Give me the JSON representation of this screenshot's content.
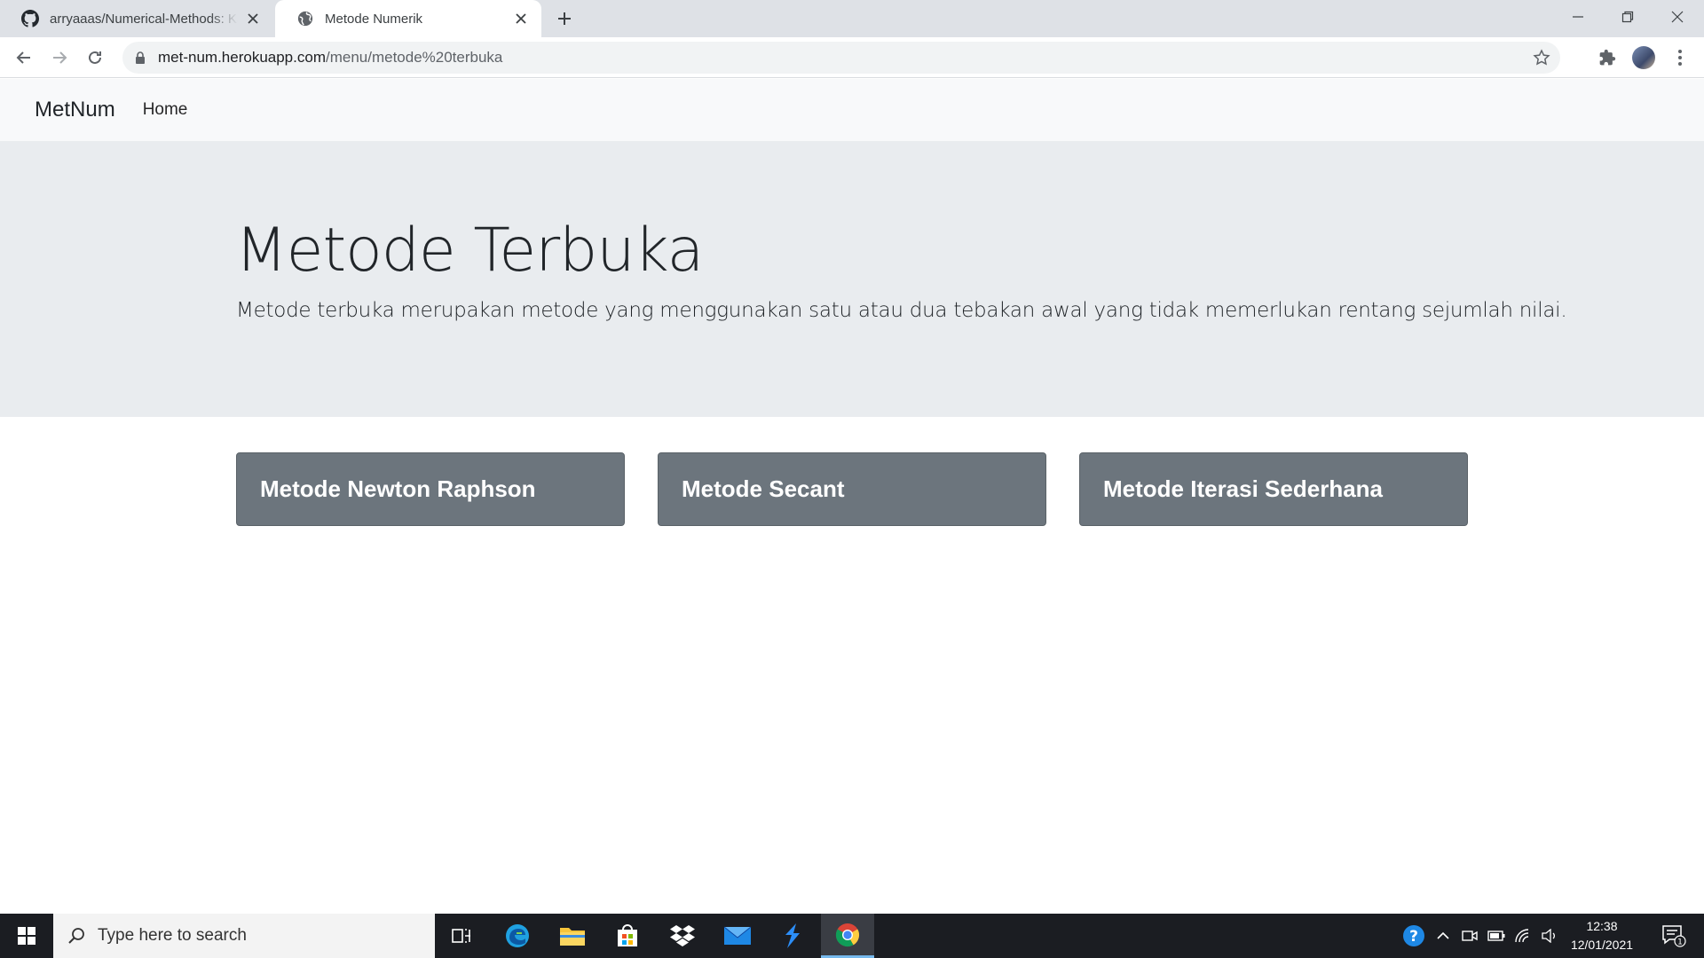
{
  "browser": {
    "tabs": [
      {
        "title": "arryaaas/Numerical-Methods: Ka",
        "icon": "github-icon",
        "active": false
      },
      {
        "title": "Metode Numerik",
        "icon": "globe-icon",
        "active": true
      }
    ],
    "url_host": "met-num.herokuapp.com",
    "url_path": "/menu/metode%20terbuka"
  },
  "navbar": {
    "brand": "MetNum",
    "links": [
      "Home"
    ]
  },
  "jumbotron": {
    "title": "Metode Terbuka",
    "lead": "Metode terbuka merupakan metode yang menggunakan satu atau dua tebakan awal yang tidak memerlukan rentang sejumlah nilai."
  },
  "methods": [
    {
      "label": "Metode Newton Raphson"
    },
    {
      "label": "Metode Secant"
    },
    {
      "label": "Metode Iterasi Sederhana"
    }
  ],
  "taskbar": {
    "search_placeholder": "Type here to search",
    "time": "12:38",
    "date": "12/01/2021",
    "notification_count": "1"
  },
  "colors": {
    "card_bg": "#6c757d",
    "jumbotron_bg": "#e9ecef",
    "navbar_bg": "#f8f9fa",
    "taskbar_bg": "#1b1d22"
  }
}
